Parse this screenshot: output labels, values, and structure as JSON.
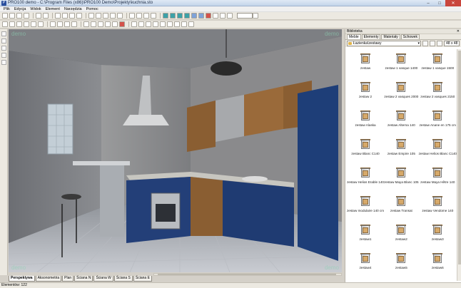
{
  "window": {
    "title": "PRO100 demo - C:\\Program Files (x86)\\PRO100 Demo\\Projekty\\kuchnia.sto",
    "icon_letter": "P",
    "minimize": "–",
    "maximize": "□",
    "close": "✕"
  },
  "menu": [
    "Plik",
    "Edycja",
    "Widok",
    "Element",
    "Narzędzia",
    "Pomoc"
  ],
  "toolbar": {
    "zoom_value": ""
  },
  "viewport": {
    "demo_watermark": "demo"
  },
  "view_tabs": [
    "Perspektywa",
    "Aksonometria",
    "Plan",
    "Ściana N",
    "Ściana W",
    "Ściana S",
    "Ściana E"
  ],
  "status": {
    "elements_text": "Elementów: 122"
  },
  "library": {
    "title": "Biblioteka",
    "close": "✕",
    "tabs": [
      "Meble",
      "Elementy",
      "Materiały",
      "Schowek"
    ],
    "path": "Łazienka\\zestawy",
    "size_value": "48 x 48",
    "items": [
      "zestaw",
      "zestaw 1 vasque 1400",
      "zestaw 1 vasque 1500",
      "zestaw 2",
      "zestaw 2 vasques 2000",
      "zestaw 2 vasques 2150",
      "zestaw Alaska",
      "zestaw Alterna 140",
      "zestaw Anane en 175 cm",
      "zestaw Blanc C140",
      "zestaw Empire 105",
      "zestaw Helios Blanc C140",
      "zestaw Helios Erable 140",
      "zestaw Maya Blanc 105",
      "zestaw Maya Hêtre 140",
      "zestaw modulaire 140 cm",
      "zestaw Transat",
      "zestaw Vendome 140",
      "zestaw1",
      "zestaw2",
      "zestaw3",
      "zestaw4",
      "zestaw5",
      "zestaw6"
    ]
  }
}
